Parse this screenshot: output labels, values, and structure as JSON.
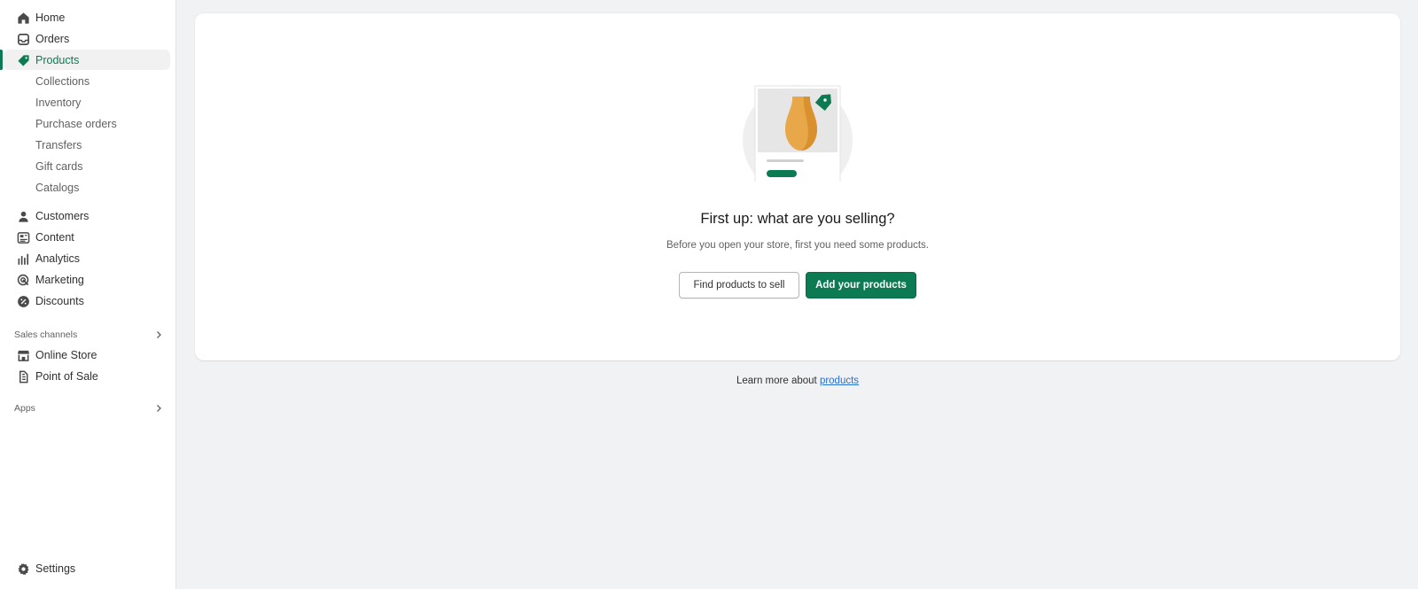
{
  "sidebar": {
    "items": [
      {
        "label": "Home",
        "icon": "home-icon"
      },
      {
        "label": "Orders",
        "icon": "inbox-icon"
      },
      {
        "label": "Products",
        "icon": "tag-icon",
        "active": true
      },
      {
        "label": "Collections"
      },
      {
        "label": "Inventory"
      },
      {
        "label": "Purchase orders"
      },
      {
        "label": "Transfers"
      },
      {
        "label": "Gift cards"
      },
      {
        "label": "Catalogs"
      },
      {
        "label": "Customers",
        "icon": "person-icon"
      },
      {
        "label": "Content",
        "icon": "content-icon"
      },
      {
        "label": "Analytics",
        "icon": "bar-chart-icon"
      },
      {
        "label": "Marketing",
        "icon": "target-icon"
      },
      {
        "label": "Discounts",
        "icon": "discount-icon"
      }
    ],
    "sales_channels": {
      "label": "Sales channels",
      "items": [
        {
          "label": "Online Store",
          "icon": "store-icon"
        },
        {
          "label": "Point of Sale",
          "icon": "pos-icon"
        }
      ]
    },
    "apps": {
      "label": "Apps"
    },
    "settings": {
      "label": "Settings",
      "icon": "gear-icon"
    }
  },
  "main": {
    "heading": "First up: what are you selling?",
    "subtext": "Before you open your store, first you need some products.",
    "secondary_button": "Find products to sell",
    "primary_button": "Add your products",
    "learn_prefix": "Learn more about",
    "learn_link": "products"
  },
  "colors": {
    "accent": "#0c7a52",
    "link": "#2c6ecb",
    "background": "#f1f2f4",
    "vase": "#e0a030"
  }
}
